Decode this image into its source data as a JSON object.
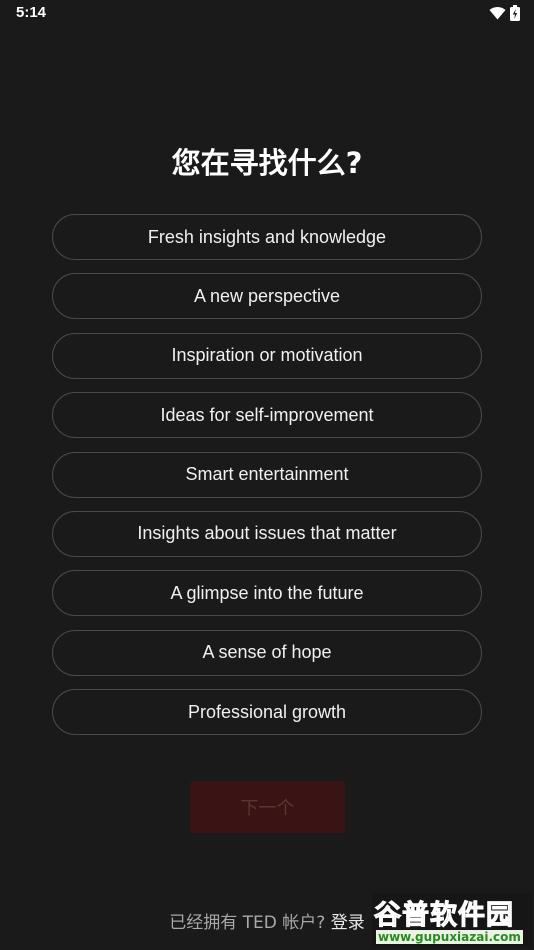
{
  "status_bar": {
    "time": "5:14"
  },
  "page": {
    "title": "您在寻找什么?"
  },
  "options": [
    {
      "label": "Fresh insights and knowledge"
    },
    {
      "label": "A new perspective"
    },
    {
      "label": "Inspiration or motivation"
    },
    {
      "label": "Ideas for self-improvement"
    },
    {
      "label": "Smart entertainment"
    },
    {
      "label": "Insights about issues that matter"
    },
    {
      "label": "A glimpse into the future"
    },
    {
      "label": "A sense of hope"
    },
    {
      "label": "Professional growth"
    }
  ],
  "next_button": {
    "label": "下一个"
  },
  "footer": {
    "prompt": "已经拥有 TED 帐户?",
    "login_label": "登录"
  },
  "watermark": {
    "brand": "谷普软件园",
    "url": "www.gupuxiazai.com"
  },
  "colors": {
    "background": "#1a1a1a",
    "option_border": "#4a4a4a",
    "next_button_bg": "#3a1414",
    "watermark_green": "#5bbf3a"
  }
}
